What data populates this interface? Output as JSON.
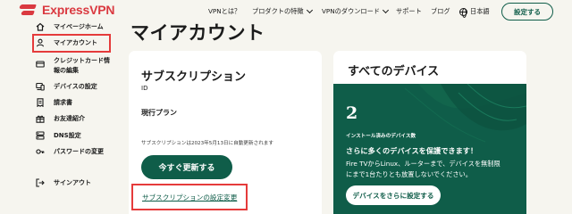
{
  "header": {
    "brand": "ExpressVPN",
    "nav": [
      {
        "label": "VPNとは？",
        "dropdown": false
      },
      {
        "label": "プロダクトの特徴",
        "dropdown": true
      },
      {
        "label": "VPNのダウンロード",
        "dropdown": true
      },
      {
        "label": "サポート",
        "dropdown": false
      },
      {
        "label": "ブログ",
        "dropdown": false
      }
    ],
    "language": "日本語",
    "settings_label": "設定する"
  },
  "sidebar": {
    "items": [
      {
        "label": "マイページホーム",
        "icon": "home-icon"
      },
      {
        "label": "マイアカウント",
        "icon": "user-icon",
        "highlighted": true
      },
      {
        "label": "クレジットカード情",
        "label2": "報の編集",
        "icon": "credit-card-icon"
      },
      {
        "label": "デバイスの設定",
        "icon": "devices-icon"
      },
      {
        "label": "請求書",
        "icon": "receipt-icon"
      },
      {
        "label": "お友達紹介",
        "icon": "gift-icon"
      },
      {
        "label": "DNS設定",
        "icon": "dns-icon"
      },
      {
        "label": "パスワードの変更",
        "icon": "key-icon"
      }
    ],
    "signout": {
      "label": "サインアウト",
      "icon": "signout-icon"
    }
  },
  "main": {
    "title": "マイアカウント",
    "subscription": {
      "title": "サブスクリプション",
      "id_label": "ID",
      "plan_label": "現行プラン",
      "renew_note": "サブスクリプションは2023年5月13日に自動更新されます",
      "renew_button": "今すぐ更新する",
      "settings_link": "サブスクリプションの設定変更"
    },
    "devices": {
      "title": "すべてのデバイス",
      "count": "2",
      "count_label": "インストール済みのデバイス数",
      "heading": "さらに多くのデバイスを保護できます！",
      "body_line1": "Fire TVからLinux、ルーターまで、デバイスを無制限",
      "body_line2": "にまで1台たりとも放置しないでください。",
      "button": "デバイスをさらに設定する"
    }
  },
  "colors": {
    "brand_red": "#da3940",
    "primary_green": "#0f5d49",
    "highlight_red": "#e53b3b",
    "background": "#f6f5ef"
  }
}
